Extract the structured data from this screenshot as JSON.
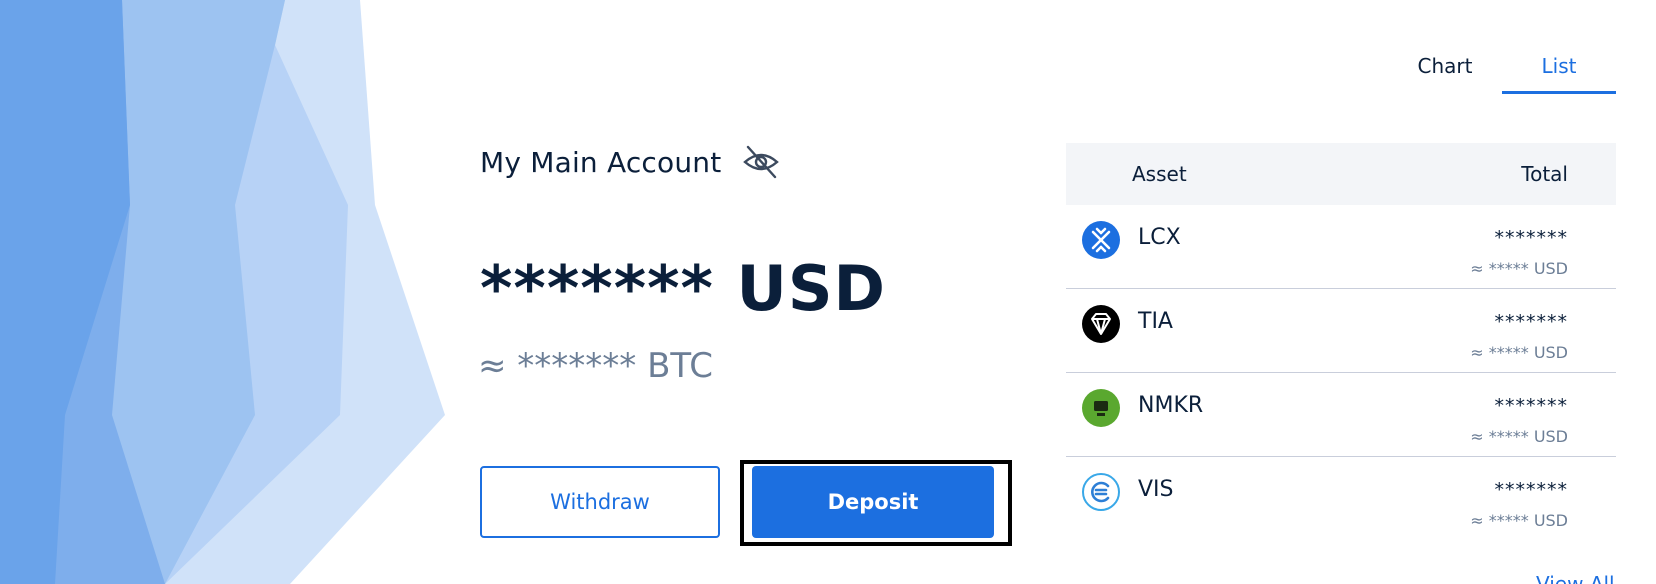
{
  "view_tabs": [
    {
      "label": "Chart",
      "active": false
    },
    {
      "label": "List",
      "active": true
    }
  ],
  "account": {
    "title": "My Main Account",
    "visibility_icon": "eye-slash-icon",
    "balance_usd": "******* USD",
    "balance_btc": "≈ ******* BTC"
  },
  "actions": {
    "withdraw_label": "Withdraw",
    "deposit_label": "Deposit"
  },
  "assets_table": {
    "headers": {
      "asset": "Asset",
      "total": "Total"
    },
    "rows": [
      {
        "symbol": "LCX",
        "quantity": "*******",
        "usd": "≈ ***** USD",
        "icon": "lcx-logo-icon"
      },
      {
        "symbol": "TIA",
        "quantity": "*******",
        "usd": "≈ ***** USD",
        "icon": "tia-logo-icon"
      },
      {
        "symbol": "NMKR",
        "quantity": "*******",
        "usd": "≈ ***** USD",
        "icon": "nmkr-logo-icon"
      },
      {
        "symbol": "VIS",
        "quantity": "*******",
        "usd": "≈ ***** USD",
        "icon": "vis-logo-icon"
      }
    ],
    "view_all_label": "View All"
  },
  "colors": {
    "primary": "#1c6fe0",
    "text_dark": "#0b1f3a",
    "text_muted": "#6c7e96",
    "table_header_bg": "#f3f5f8"
  }
}
